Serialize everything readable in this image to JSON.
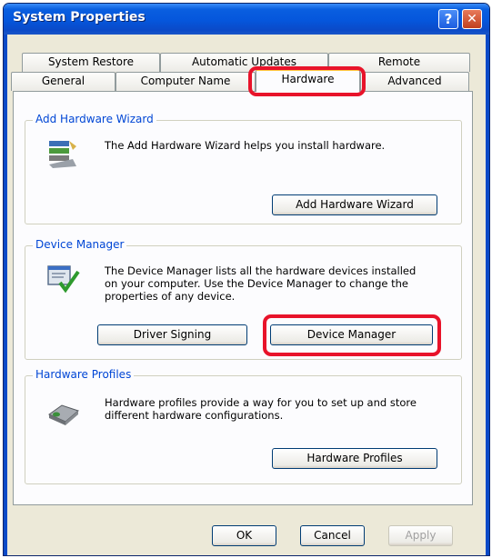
{
  "window": {
    "title": "System Properties",
    "help_glyph": "?",
    "close_glyph": "✕"
  },
  "tabs": {
    "row1": [
      "System Restore",
      "Automatic Updates",
      "Remote"
    ],
    "row2": [
      "General",
      "Computer Name",
      "Hardware",
      "Advanced"
    ],
    "selected": "Hardware"
  },
  "add_hardware": {
    "group_label": "Add Hardware Wizard",
    "description": "The Add Hardware Wizard helps you install hardware.",
    "button": "Add Hardware Wizard",
    "icon": "add-hardware-wizard-icon"
  },
  "device_manager": {
    "group_label": "Device Manager",
    "description_lines": [
      "The Device Manager lists all the hardware devices installed",
      "on your computer. Use the Device Manager to change the",
      "properties of any device."
    ],
    "driver_signing_button": "Driver Signing",
    "device_manager_button": "Device Manager",
    "icon": "device-manager-icon"
  },
  "hardware_profiles": {
    "group_label": "Hardware Profiles",
    "description_lines": [
      "Hardware profiles provide a way for you to set up and store",
      "different hardware configurations."
    ],
    "button": "Hardware Profiles",
    "icon": "hardware-profiles-icon"
  },
  "footer": {
    "ok": "OK",
    "cancel": "Cancel",
    "apply": "Apply"
  },
  "colors": {
    "title_bar": "#0556dc",
    "group_label": "#0046d5",
    "highlight": "#e8132a",
    "selected_tab_accent": "#ffc83c"
  }
}
